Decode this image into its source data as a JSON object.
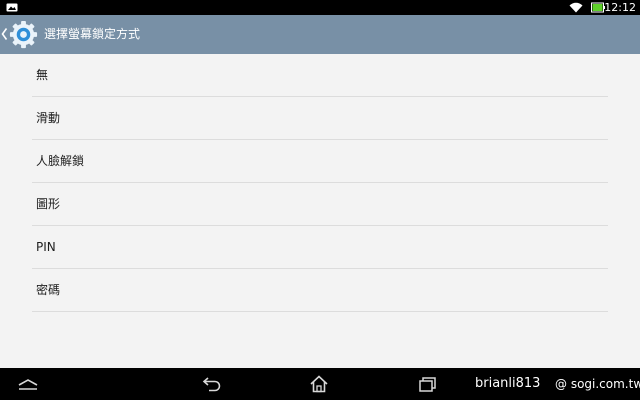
{
  "status_bar": {
    "time": "12:12",
    "notification_icon": "image-notification-icon",
    "wifi_icon": "wifi-icon",
    "battery_icon": "battery-charging-icon",
    "battery_color": "#5fd12a"
  },
  "action_bar": {
    "title": "選擇螢幕鎖定方式",
    "background": "#7890a6",
    "up_icon": "chevron-left-icon",
    "app_icon": "settings-gear-icon"
  },
  "options": [
    {
      "label": "無"
    },
    {
      "label": "滑動"
    },
    {
      "label": "人臉解鎖"
    },
    {
      "label": "圖形"
    },
    {
      "label": "PIN"
    },
    {
      "label": "密碼"
    }
  ],
  "nav_bar": {
    "buttons": [
      "menu-up-icon",
      "back-icon",
      "home-icon",
      "recent-apps-icon"
    ]
  },
  "watermark": {
    "user": "brianli813",
    "site": "@ sogi.com.tw"
  }
}
